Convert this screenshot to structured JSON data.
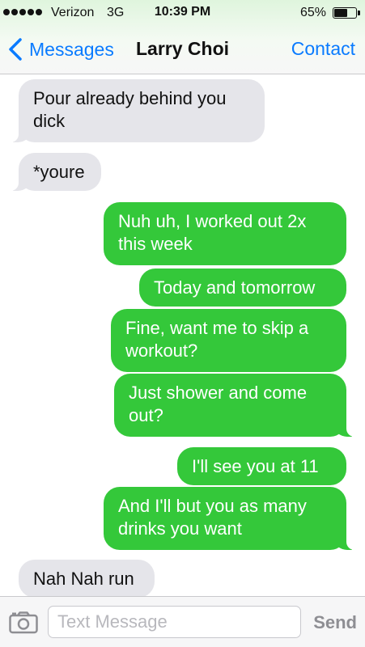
{
  "status_bar": {
    "signal_bars": 5,
    "carrier": "Verizon",
    "network": "3G",
    "time": "10:39 PM",
    "battery_percent_label": "65%",
    "battery_level": 0.65
  },
  "nav": {
    "back_label": "Messages",
    "title": "Larry Choi",
    "contact_label": "Contact"
  },
  "colors": {
    "accent": "#0a7bff",
    "outgoing_bubble": "#34c83a",
    "incoming_bubble": "#e5e5ea"
  },
  "messages": [
    {
      "direction": "in",
      "text": "Pour already behind you\ndick",
      "tail": true
    },
    {
      "direction": "in",
      "text": "*youre",
      "tail": true
    },
    {
      "direction": "out",
      "text": "Nuh uh, I worked out 2x\nthis week",
      "tail": false
    },
    {
      "direction": "out",
      "text": "Today and tomorrow",
      "tail": false
    },
    {
      "direction": "out",
      "text": "Fine, want me to skip a\nworkout?",
      "tail": false
    },
    {
      "direction": "out",
      "text": "Just shower and come\nout?",
      "tail": true
    },
    {
      "direction": "out",
      "text": "I'll see you at 11",
      "tail": false
    },
    {
      "direction": "out",
      "text": "And I'll but you as many\ndrinks you want",
      "tail": true
    },
    {
      "direction": "in",
      "text": "Nah Nah run",
      "tail": false
    }
  ],
  "composer": {
    "camera_icon": "camera-icon",
    "placeholder": "Text Message",
    "value": "",
    "send_label": "Send"
  }
}
